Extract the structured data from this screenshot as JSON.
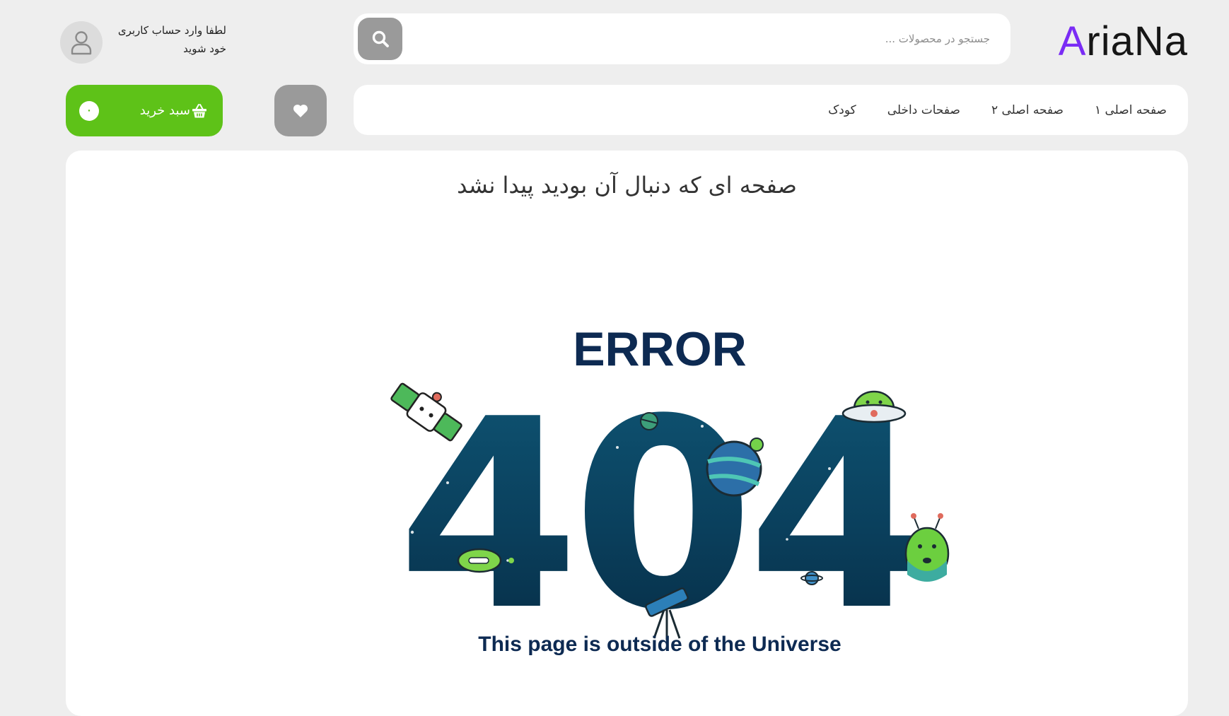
{
  "header": {
    "logo": {
      "accent_letter": "A",
      "rest": "riaNa",
      "accent_color": "#7a2cf5"
    },
    "search": {
      "placeholder": "جستجو در محصولات ...",
      "value": "",
      "button_icon": "search-icon"
    },
    "account": {
      "line1": "لطفا وارد حساب کاربری",
      "line2": "خود شوید",
      "icon": "user-icon"
    }
  },
  "nav": {
    "items": [
      {
        "label": "صفحه اصلی ۱"
      },
      {
        "label": "صفحه اصلی ۲"
      },
      {
        "label": "صفحات داخلی"
      },
      {
        "label": "کودک"
      }
    ]
  },
  "wishlist": {
    "icon": "heart-icon"
  },
  "cart": {
    "label": "سبد خرید",
    "count": "۰",
    "icon": "basket-icon",
    "color": "#5ec218"
  },
  "main": {
    "title": "صفحه ای که دنبال آن بودید پیدا نشد",
    "illustration": {
      "heading": "ERROR",
      "code": "404",
      "tagline": "This page is outside of the Universe"
    }
  }
}
